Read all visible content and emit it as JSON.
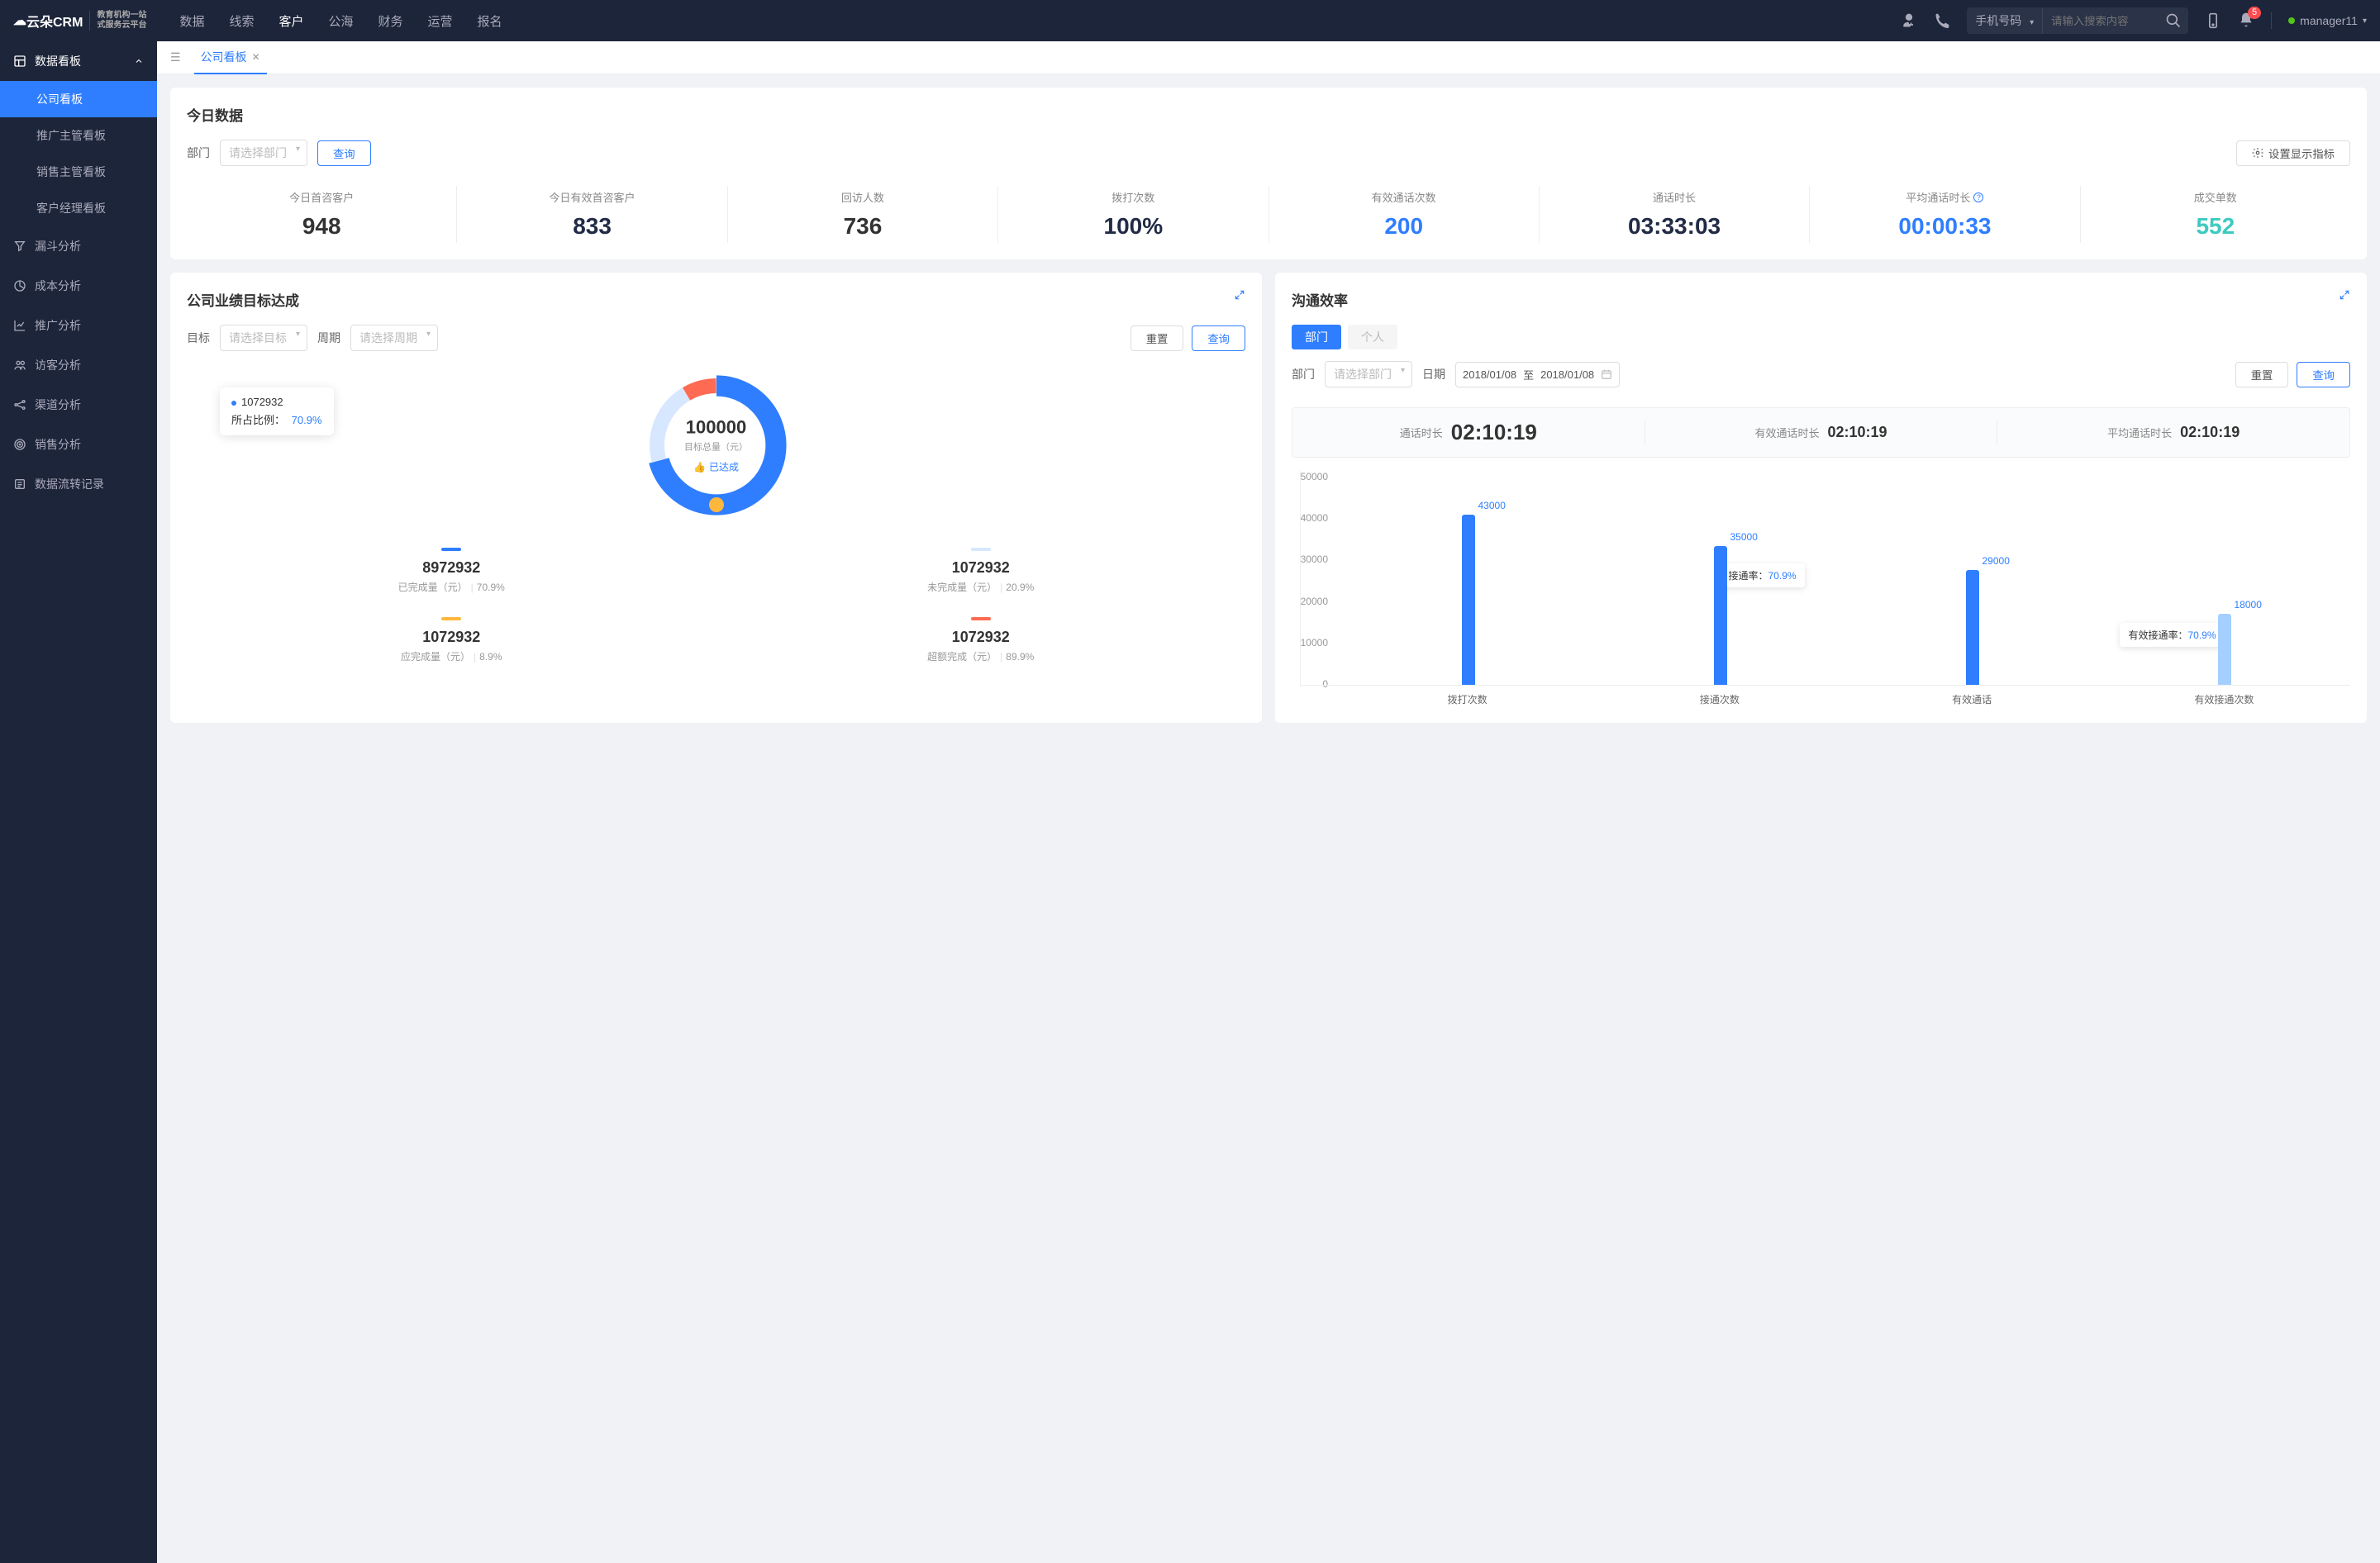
{
  "header": {
    "logo": "云朵CRM",
    "logo_sub1": "教育机构一站",
    "logo_sub2": "式服务云平台",
    "nav": [
      "数据",
      "线索",
      "客户",
      "公海",
      "财务",
      "运营",
      "报名"
    ],
    "active_nav": 2,
    "search_type": "手机号码",
    "search_placeholder": "请输入搜索内容",
    "badge": "5",
    "user": "manager11"
  },
  "sidebar": {
    "group_label": "数据看板",
    "subs": [
      "公司看板",
      "推广主管看板",
      "销售主管看板",
      "客户经理看板"
    ],
    "active_sub": 0,
    "items": [
      {
        "label": "漏斗分析"
      },
      {
        "label": "成本分析"
      },
      {
        "label": "推广分析"
      },
      {
        "label": "访客分析"
      },
      {
        "label": "渠道分析"
      },
      {
        "label": "销售分析"
      },
      {
        "label": "数据流转记录"
      }
    ]
  },
  "tabs": {
    "active": "公司看板"
  },
  "today": {
    "title": "今日数据",
    "filter_label": "部门",
    "dept_placeholder": "请选择部门",
    "btn_query": "查询",
    "btn_settings": "设置显示指标",
    "stats": [
      {
        "label": "今日首咨客户",
        "value": "948",
        "color": "#333"
      },
      {
        "label": "今日有效首咨客户",
        "value": "833",
        "color": "#222b45"
      },
      {
        "label": "回访人数",
        "value": "736",
        "color": "#333"
      },
      {
        "label": "拨打次数",
        "value": "100%",
        "color": "#222b45"
      },
      {
        "label": "有效通话次数",
        "value": "200",
        "color": "#2e7eff"
      },
      {
        "label": "通话时长",
        "value": "03:33:03",
        "color": "#222b45"
      },
      {
        "label": "平均通话时长",
        "value": "00:00:33",
        "color": "#2e7eff",
        "info": true
      },
      {
        "label": "成交单数",
        "value": "552",
        "color": "#3dcac0"
      }
    ]
  },
  "goal": {
    "title": "公司业绩目标达成",
    "target_label": "目标",
    "target_placeholder": "请选择目标",
    "period_label": "周期",
    "period_placeholder": "请选择周期",
    "btn_reset": "重置",
    "btn_query": "查询",
    "center_value": "100000",
    "center_label": "目标总量（元）",
    "status": "已达成",
    "tooltip_value": "1072932",
    "tooltip_ratio_label": "所占比例：",
    "tooltip_ratio": "70.9%",
    "dstats": [
      {
        "color": "#2e7eff",
        "value": "8972932",
        "label": "已完成量（元）",
        "pct": "70.9%"
      },
      {
        "color": "#d7e7ff",
        "value": "1072932",
        "label": "未完成量（元）",
        "pct": "20.9%"
      },
      {
        "color": "#ffb83d",
        "value": "1072932",
        "label": "应完成量（元）",
        "pct": "8.9%"
      },
      {
        "color": "#ff6b52",
        "value": "1072932",
        "label": "超额完成（元）",
        "pct": "89.9%"
      }
    ]
  },
  "comm": {
    "title": "沟通效率",
    "seg_dept": "部门",
    "seg_person": "个人",
    "dept_label": "部门",
    "dept_placeholder": "请选择部门",
    "date_label": "日期",
    "date_from": "2018/01/08",
    "date_to": "2018/01/08",
    "date_sep": "至",
    "btn_reset": "重置",
    "btn_query": "查询",
    "time_stats": [
      {
        "label": "通话时长",
        "value": "02:10:19",
        "big": true
      },
      {
        "label": "有效通话时长",
        "value": "02:10:19"
      },
      {
        "label": "平均通话时长",
        "value": "02:10:19"
      }
    ],
    "tooltip1_label": "接通率：",
    "tooltip1_value": "70.9%",
    "tooltip2_label": "有效接通率：",
    "tooltip2_value": "70.9%"
  },
  "chart_data": {
    "type": "bar",
    "categories": [
      "拨打次数",
      "接通次数",
      "有效通话",
      "有效接通次数"
    ],
    "values": [
      43000,
      35000,
      29000,
      18000
    ],
    "value_labels": [
      "43000",
      "35000",
      "29000",
      "18000"
    ],
    "ylim": [
      0,
      50000
    ],
    "yticks": [
      0,
      10000,
      20000,
      30000,
      40000,
      50000
    ],
    "light_bars": [
      3
    ],
    "ylabel": "",
    "xlabel": ""
  }
}
